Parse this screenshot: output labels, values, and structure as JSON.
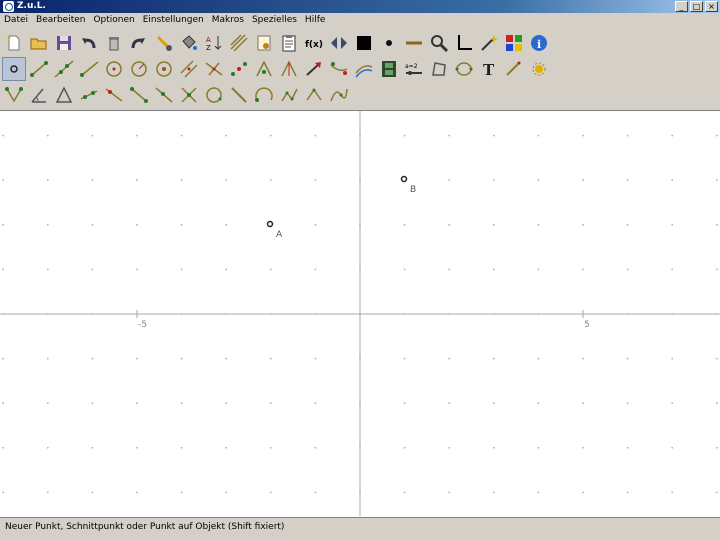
{
  "window": {
    "title": "Z.u.L."
  },
  "window_buttons": [
    "_",
    "□",
    "×"
  ],
  "menu": [
    "Datei",
    "Bearbeiten",
    "Optionen",
    "Einstellungen",
    "Makros",
    "Spezielles",
    "Hilfe"
  ],
  "axes": {
    "x_tick_labels": [
      "-5",
      "5"
    ]
  },
  "points": [
    {
      "label": "B"
    },
    {
      "label": "A"
    }
  ],
  "status": {
    "text": "Neuer Punkt, Schnittpunkt oder Punkt auf Objekt (Shift fixiert)"
  },
  "colors": {
    "titlebar_start": "#0a246a",
    "chrome": "#d4d0c8",
    "construction": "#8a7a2a",
    "point_green": "#2a7a2a"
  }
}
